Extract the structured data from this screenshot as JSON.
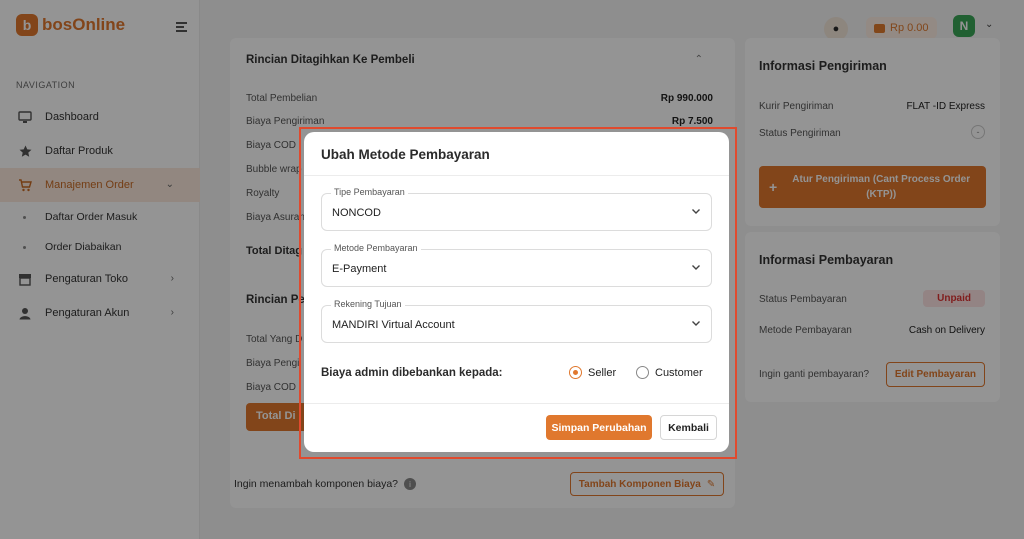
{
  "brand": {
    "name": "bosOnline",
    "mark": "b"
  },
  "sidebar": {
    "heading": "NAVIGATION",
    "items": [
      {
        "label": "Dashboard",
        "icon": "monitor-icon"
      },
      {
        "label": "Daftar Produk",
        "icon": "star-icon"
      },
      {
        "label": "Manajemen Order",
        "icon": "cart-icon",
        "active": true
      },
      {
        "label": "Daftar Order Masuk",
        "sub": true
      },
      {
        "label": "Order Diabaikan",
        "sub": true
      },
      {
        "label": "Pengaturan Toko",
        "icon": "store-icon"
      },
      {
        "label": "Pengaturan Akun",
        "icon": "user-icon"
      }
    ]
  },
  "header": {
    "balance": "Rp 0.00",
    "user_initial": "N"
  },
  "billing": {
    "title": "Rincian Ditagihkan Ke Pembeli",
    "rows": [
      {
        "label": "Total Pembelian",
        "value": "Rp 990.000"
      },
      {
        "label": "Biaya Pengiriman",
        "value": "Rp 7.500"
      },
      {
        "label": "Biaya COD",
        "value": ""
      },
      {
        "label": "Bubble wrap",
        "value": ""
      },
      {
        "label": "Royalty",
        "value": ""
      },
      {
        "label": "Biaya Asuransi",
        "value": ""
      }
    ],
    "total_label": "Total Ditag",
    "section2_title": "Rincian Pe",
    "rows2": [
      {
        "label": "Total Yang D"
      },
      {
        "label": "Biaya Pengi"
      },
      {
        "label": "Biaya COD"
      }
    ],
    "total_button": "Total Di",
    "footer_question": "Ingin menambah komponen biaya?",
    "add_button": "Tambah Komponen Biaya"
  },
  "shipping": {
    "title": "Informasi Pengiriman",
    "courier_label": "Kurir Pengiriman",
    "courier_value": "FLAT -ID Express",
    "status_label": "Status Pengiriman",
    "status_value": "-",
    "button": "Atur Pengiriman (Cant Process Order (KTP))"
  },
  "payment": {
    "title": "Informasi Pembayaran",
    "status_label": "Status Pembayaran",
    "status_value": "Unpaid",
    "method_label": "Metode Pembayaran",
    "method_value": "Cash on Delivery",
    "change_question": "Ingin ganti pembayaran?",
    "edit_button": "Edit Pembayaran"
  },
  "modal": {
    "title": "Ubah Metode Pembayaran",
    "fields": [
      {
        "label": "Tipe Pembayaran",
        "value": "NONCOD"
      },
      {
        "label": "Metode Pembayaran",
        "value": "E-Payment"
      },
      {
        "label": "Rekening Tujuan",
        "value": "MANDIRI Virtual Account"
      }
    ],
    "admin_fee_question": "Biaya admin dibebankan kepada:",
    "options": [
      {
        "label": "Seller",
        "checked": true
      },
      {
        "label": "Customer",
        "checked": false
      }
    ],
    "save_label": "Simpan Perubahan",
    "back_label": "Kembali"
  },
  "colors": {
    "accent": "#e0782e",
    "highlight": "#e04a2e",
    "success": "#3aa557",
    "danger": "#d33333"
  }
}
